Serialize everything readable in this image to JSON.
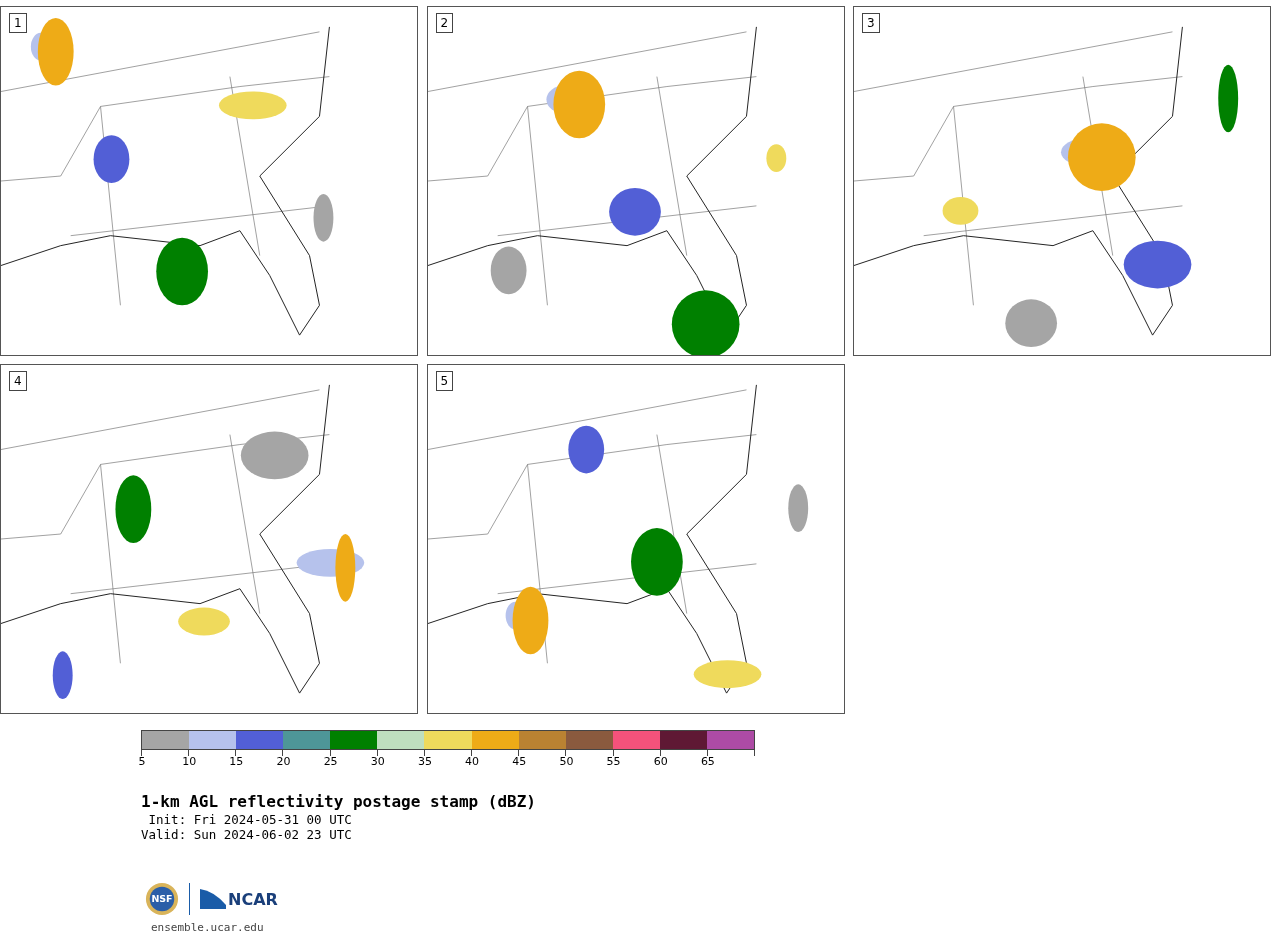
{
  "panels": [
    {
      "label": "1"
    },
    {
      "label": "2"
    },
    {
      "label": "3"
    },
    {
      "label": "4"
    },
    {
      "label": "5"
    }
  ],
  "colorbar": {
    "bins": [
      {
        "color": "#a5a5a5"
      },
      {
        "color": "#b6c2ec"
      },
      {
        "color": "#525fd6"
      },
      {
        "color": "#4e9698"
      },
      {
        "color": "#008000"
      },
      {
        "color": "#bfdfbf"
      },
      {
        "color": "#efda5c"
      },
      {
        "color": "#eeab17"
      },
      {
        "color": "#ba8232"
      },
      {
        "color": "#8a5a3e"
      },
      {
        "color": "#f4527b"
      },
      {
        "color": "#5f1834"
      },
      {
        "color": "#ad4ba5"
      }
    ],
    "ticks": [
      "5",
      "10",
      "15",
      "20",
      "25",
      "30",
      "35",
      "40",
      "45",
      "50",
      "55",
      "60",
      "65"
    ]
  },
  "title": "1-km AGL reflectivity postage stamp (dBZ)",
  "init": " Init: Fri 2024-05-31 00 UTC",
  "valid": "Valid: Sun 2024-06-02 23 UTC",
  "logos": {
    "nsf": "NSF",
    "ncar": "NCAR"
  },
  "url": "ensemble.ucar.edu"
}
